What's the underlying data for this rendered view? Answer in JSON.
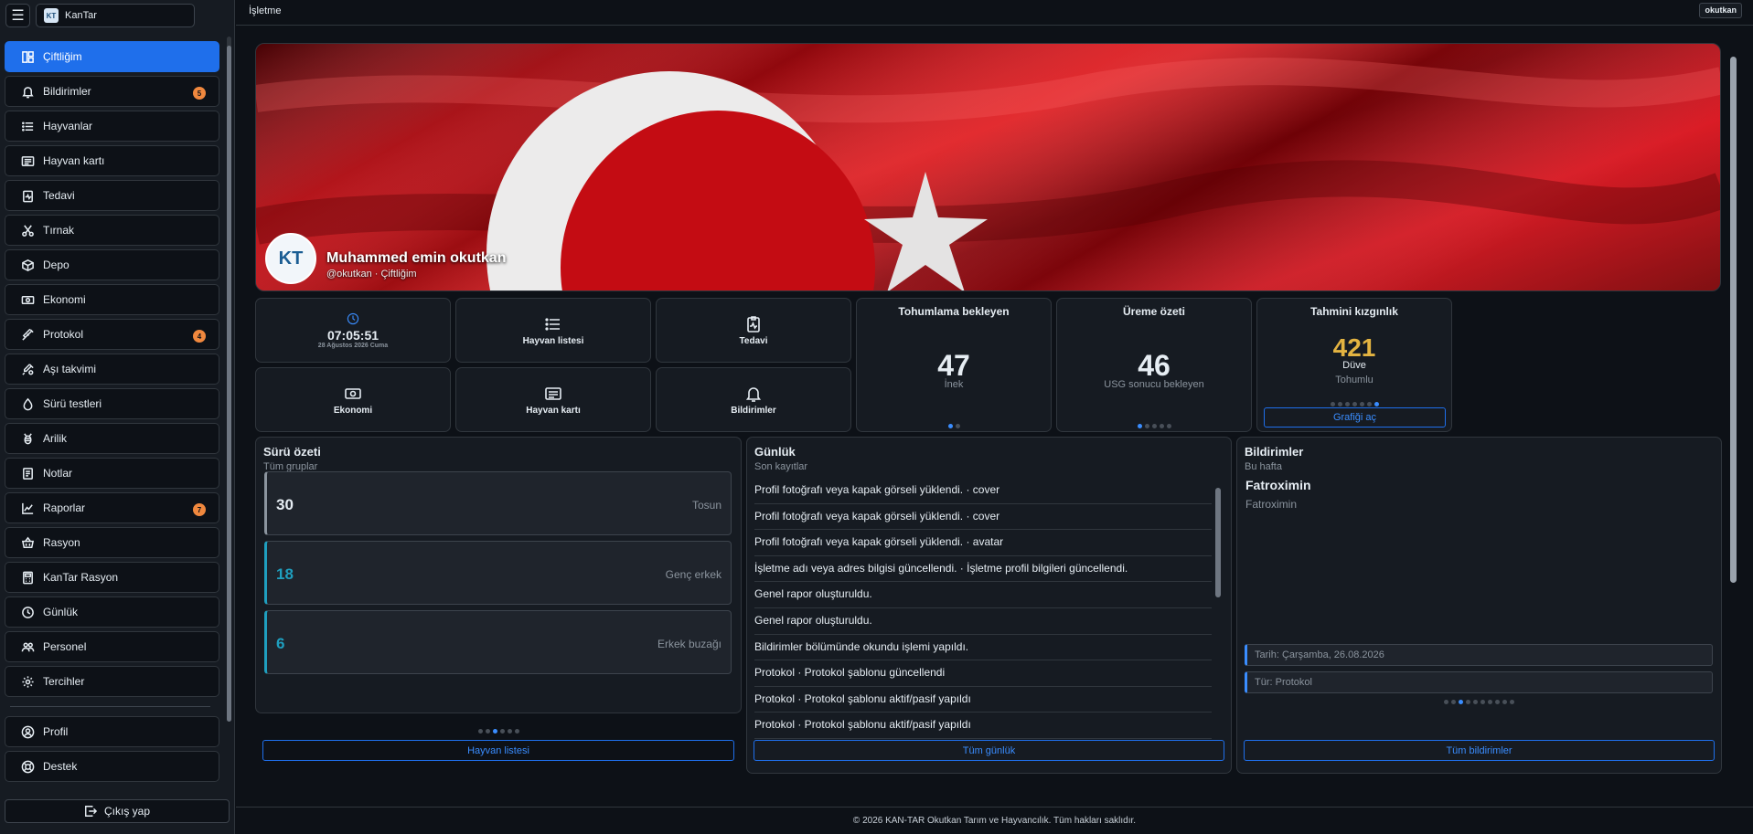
{
  "app": {
    "brand": "KanTar",
    "logo_text": "KT"
  },
  "topbar": {
    "title": "İşletme",
    "user": "okutkan"
  },
  "sidebar": {
    "items": [
      {
        "label": "Çiftliğim",
        "icon": "dashboard-icon",
        "active": true
      },
      {
        "label": "Bildirimler",
        "icon": "bell-icon",
        "badge": "5"
      },
      {
        "label": "Hayvanlar",
        "icon": "list-icon"
      },
      {
        "label": "Hayvan kartı",
        "icon": "card-icon"
      },
      {
        "label": "Tedavi",
        "icon": "clipboard-pulse-icon"
      },
      {
        "label": "Tırnak",
        "icon": "scissors-icon"
      },
      {
        "label": "Depo",
        "icon": "box-icon"
      },
      {
        "label": "Ekonomi",
        "icon": "cash-icon"
      },
      {
        "label": "Protokol",
        "icon": "syringe-icon",
        "badge": "4"
      },
      {
        "label": "Aşı takvimi",
        "icon": "vaccine-icon"
      },
      {
        "label": "Sürü testleri",
        "icon": "droplet-icon"
      },
      {
        "label": "Arilik",
        "icon": "bee-icon"
      },
      {
        "label": "Notlar",
        "icon": "notes-icon"
      },
      {
        "label": "Raporlar",
        "icon": "chart-line-icon",
        "badge": "7"
      },
      {
        "label": "Rasyon",
        "icon": "basket-icon"
      },
      {
        "label": "KanTar Rasyon",
        "icon": "calculator-icon"
      },
      {
        "label": "Günlük",
        "icon": "clock-icon"
      },
      {
        "label": "Personel",
        "icon": "people-icon"
      },
      {
        "label": "Tercihler",
        "icon": "gear-icon"
      }
    ],
    "bottom_items": [
      {
        "label": "Profil",
        "icon": "user-circle-icon"
      },
      {
        "label": "Destek",
        "icon": "lifebuoy-icon"
      }
    ],
    "logout": "Çıkış yap"
  },
  "hero": {
    "avatar_text": "KT",
    "name": "Muhammed emin okutkan",
    "subtitle": "@okutkan · Çiftliğim"
  },
  "tiles": {
    "clock": {
      "time": "07:05:51",
      "date": "28 Ağustos 2026 Cuma"
    },
    "animal_list": "Hayvan listesi",
    "treatment": "Tedavi",
    "economy": "Ekonomi",
    "animal_card": "Hayvan kartı",
    "notifications": "Bildirimler"
  },
  "stats": {
    "insemination": {
      "title": "Tohumlama bekleyen",
      "value": "47",
      "label": "İnek",
      "dots": 2,
      "active_dot": 0
    },
    "breeding": {
      "title": "Üreme özeti",
      "value": "46",
      "label": "USG sonucu bekleyen",
      "dots": 5,
      "active_dot": 0
    },
    "estrus": {
      "title": "Tahmini kızgınlık",
      "value": "421",
      "label": "Düve",
      "sublabel": "Tohumlu",
      "dots": 7,
      "active_dot": 6,
      "button": "Grafiği aç",
      "value_color": "#e3b341"
    }
  },
  "herd": {
    "title": "Sürü özeti",
    "subtitle": "Tüm gruplar",
    "items": [
      {
        "value": "30",
        "label": "Tosun",
        "color": "#8b949e"
      },
      {
        "value": "18",
        "label": "Genç erkek",
        "color": "#1f9fbf"
      },
      {
        "value": "6",
        "label": "Erkek buzağı",
        "color": "#1f9fbf"
      }
    ],
    "dots": 6,
    "active_dot": 2,
    "button": "Hayvan listesi"
  },
  "log": {
    "title": "Günlük",
    "subtitle": "Son kayıtlar",
    "items": [
      "Profil fotoğrafı veya kapak görseli yüklendi. · cover",
      "Profil fotoğrafı veya kapak görseli yüklendi. · cover",
      "Profil fotoğrafı veya kapak görseli yüklendi. · avatar",
      "İşletme adı veya adres bilgisi güncellendi. · İşletme profil bilgileri güncellendi.",
      "Genel rapor oluşturuldu.",
      "Genel rapor oluşturuldu.",
      "Bildirimler bölümünde okundu işlemi yapıldı.",
      "Protokol · Protokol şablonu güncellendi",
      "Protokol · Protokol şablonu aktif/pasif yapıldı",
      "Protokol · Protokol şablonu aktif/pasif yapıldı"
    ],
    "button": "Tüm günlük"
  },
  "notifications": {
    "title": "Bildirimler",
    "subtitle": "Bu hafta",
    "heading": "Fatroximin",
    "body": "Fatroximin",
    "date": "Tarih: Çarşamba, 26.08.2026",
    "type": "Tür: Protokol",
    "dots": 10,
    "active_dot": 2,
    "button": "Tüm bildirimler"
  },
  "footer": "© 2026 KAN-TAR Okutkan Tarım ve Hayvancılık. Tüm hakları saklıdır."
}
